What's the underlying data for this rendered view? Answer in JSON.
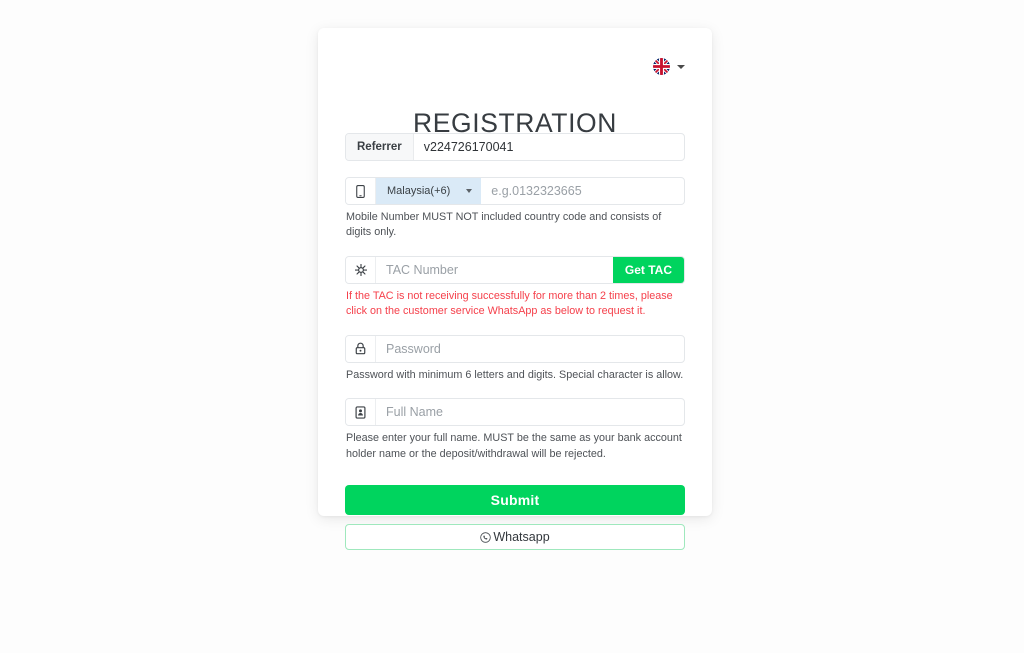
{
  "language": {
    "selected": "English",
    "flag_icon": "uk-flag-icon",
    "caret_icon": "chevron-down-icon"
  },
  "page_title": "REGISTRATION",
  "form": {
    "referrer": {
      "label": "Referrer",
      "value": "v224726170041"
    },
    "mobile": {
      "icon": "mobile-phone-icon",
      "country": "Malaysia(+6)",
      "placeholder": "e.g.0132323665",
      "helper": "Mobile Number MUST NOT included country code and consists of digits only."
    },
    "tac": {
      "icon": "tac-key-icon",
      "placeholder": "TAC Number",
      "button_label": "Get TAC",
      "helper": "If the TAC is not receiving successfully for more than 2 times, please click on the customer service WhatsApp as below to request it."
    },
    "password": {
      "icon": "lock-icon",
      "placeholder": "Password",
      "helper": "Password with minimum 6 letters and digits. Special character is allow."
    },
    "fullname": {
      "icon": "id-card-icon",
      "placeholder": "Full Name",
      "helper": "Please enter your full name. MUST be the same as your bank account holder name or the deposit/withdrawal will be rejected."
    }
  },
  "actions": {
    "submit_label": "Submit",
    "whatsapp_label": "Whatsapp",
    "whatsapp_icon": "whatsapp-icon"
  },
  "colors": {
    "primary_green": "#00d45e",
    "warning_red": "#f5404b",
    "country_bg": "#daeaf7",
    "whatsapp_border": "#9fe8bd"
  }
}
